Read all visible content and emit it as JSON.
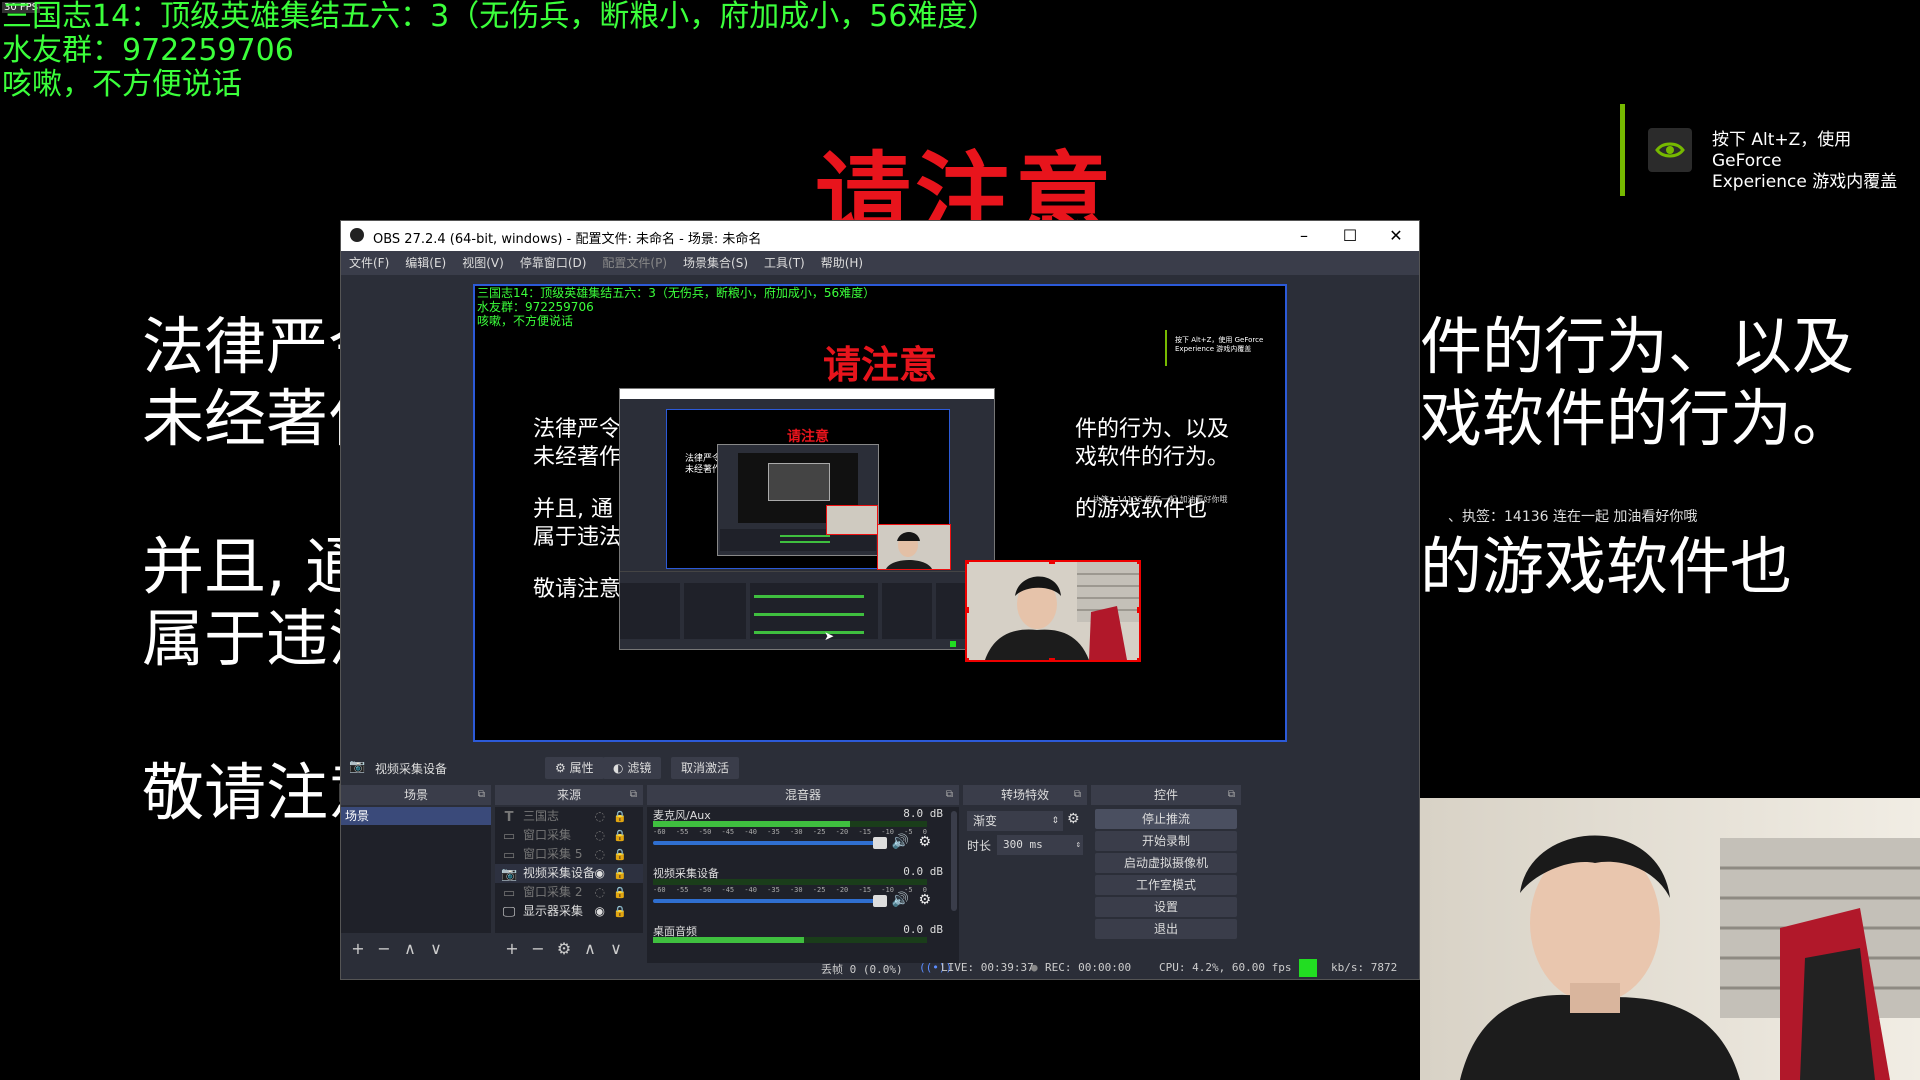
{
  "overlay": {
    "fps_tag": "30 FPS",
    "line1": "三国志14：顶级英雄集结五六：3（无伤兵，断粮小，府加成小，56难度）",
    "line2": "水友群：972259706",
    "line3": "咳嗽，不方便说话"
  },
  "notice": {
    "title": "请注意",
    "para1_line1_left": "法律严令",
    "para1_line1_right": "件的行为、以及",
    "para1_line2_left": "未经著作",
    "para1_line2_right": "戏软件的行为。",
    "para2_line1_left": "并且, 通",
    "para2_line1_right": "的游戏软件也",
    "para2_line2_left": "属于违法",
    "closing": "敬请注意"
  },
  "gfe": {
    "line1": "按下 Alt+Z，使用 GeForce",
    "line2": "Experience 游戏内覆盖"
  },
  "danmaku": "、执签：14136 连在一起 加油看好你哦",
  "obs": {
    "title": "OBS 27.2.4 (64-bit, windows) - 配置文件: 未命名 - 场景: 未命名",
    "menu": [
      "文件(F)",
      "编辑(E)",
      "视图(V)",
      "停靠窗口(D)",
      "配置文件(P)",
      "场景集合(S)",
      "工具(T)",
      "帮助(H)"
    ],
    "menu_disabled_index": 4,
    "source_bar": {
      "selected_source": "视频采集设备",
      "properties": "属性",
      "filters": "滤镜",
      "deactivate": "取消激活"
    },
    "docks": {
      "scenes": "场景",
      "sources": "来源",
      "mixer": "混音器",
      "transitions": "转场特效",
      "controls": "控件"
    },
    "scenes": [
      "场景"
    ],
    "sources": [
      {
        "name": "三国志",
        "icon": "text-icon",
        "visible": false
      },
      {
        "name": "窗口采集",
        "icon": "window-icon",
        "visible": false
      },
      {
        "name": "窗口采集 5",
        "icon": "window-icon",
        "visible": false
      },
      {
        "name": "视频采集设备",
        "icon": "camera-icon",
        "visible": true
      },
      {
        "name": "窗口采集 2",
        "icon": "window-icon",
        "visible": false
      },
      {
        "name": "显示器采集",
        "icon": "monitor-icon",
        "visible": true
      }
    ],
    "mixer": [
      {
        "name": "麦克风/Aux",
        "db": "8.0 dB",
        "level": 0.72
      },
      {
        "name": "视频采集设备",
        "db": "0.0 dB",
        "level": 0.0
      },
      {
        "name": "桌面音频",
        "db": "0.0 dB",
        "level": 0.55
      }
    ],
    "meter_ticks": [
      "-60",
      "-55",
      "-50",
      "-45",
      "-40",
      "-35",
      "-30",
      "-25",
      "-20",
      "-15",
      "-10",
      "-5",
      "0"
    ],
    "transition": {
      "type": "渐变",
      "duration_label": "时长",
      "duration": "300 ms"
    },
    "controls": [
      "停止推流",
      "开始录制",
      "启动虚拟摄像机",
      "工作室模式",
      "设置",
      "退出"
    ],
    "status": {
      "dropped": "丢帧 0 (0.0%)",
      "live": "LIVE: 00:39:37",
      "rec": "REC: 00:00:00",
      "cpu": "CPU: 4.2%, 60.00 fps",
      "kbs": "kb/s: 7872"
    }
  },
  "colors": {
    "overlay_green": "#3bff3b",
    "notice_red": "#e8141c",
    "obs_bg": "#2b2e38",
    "preview_border": "#2c5ad8",
    "nvidia_green": "#76b900",
    "status_green": "#22dd22"
  }
}
